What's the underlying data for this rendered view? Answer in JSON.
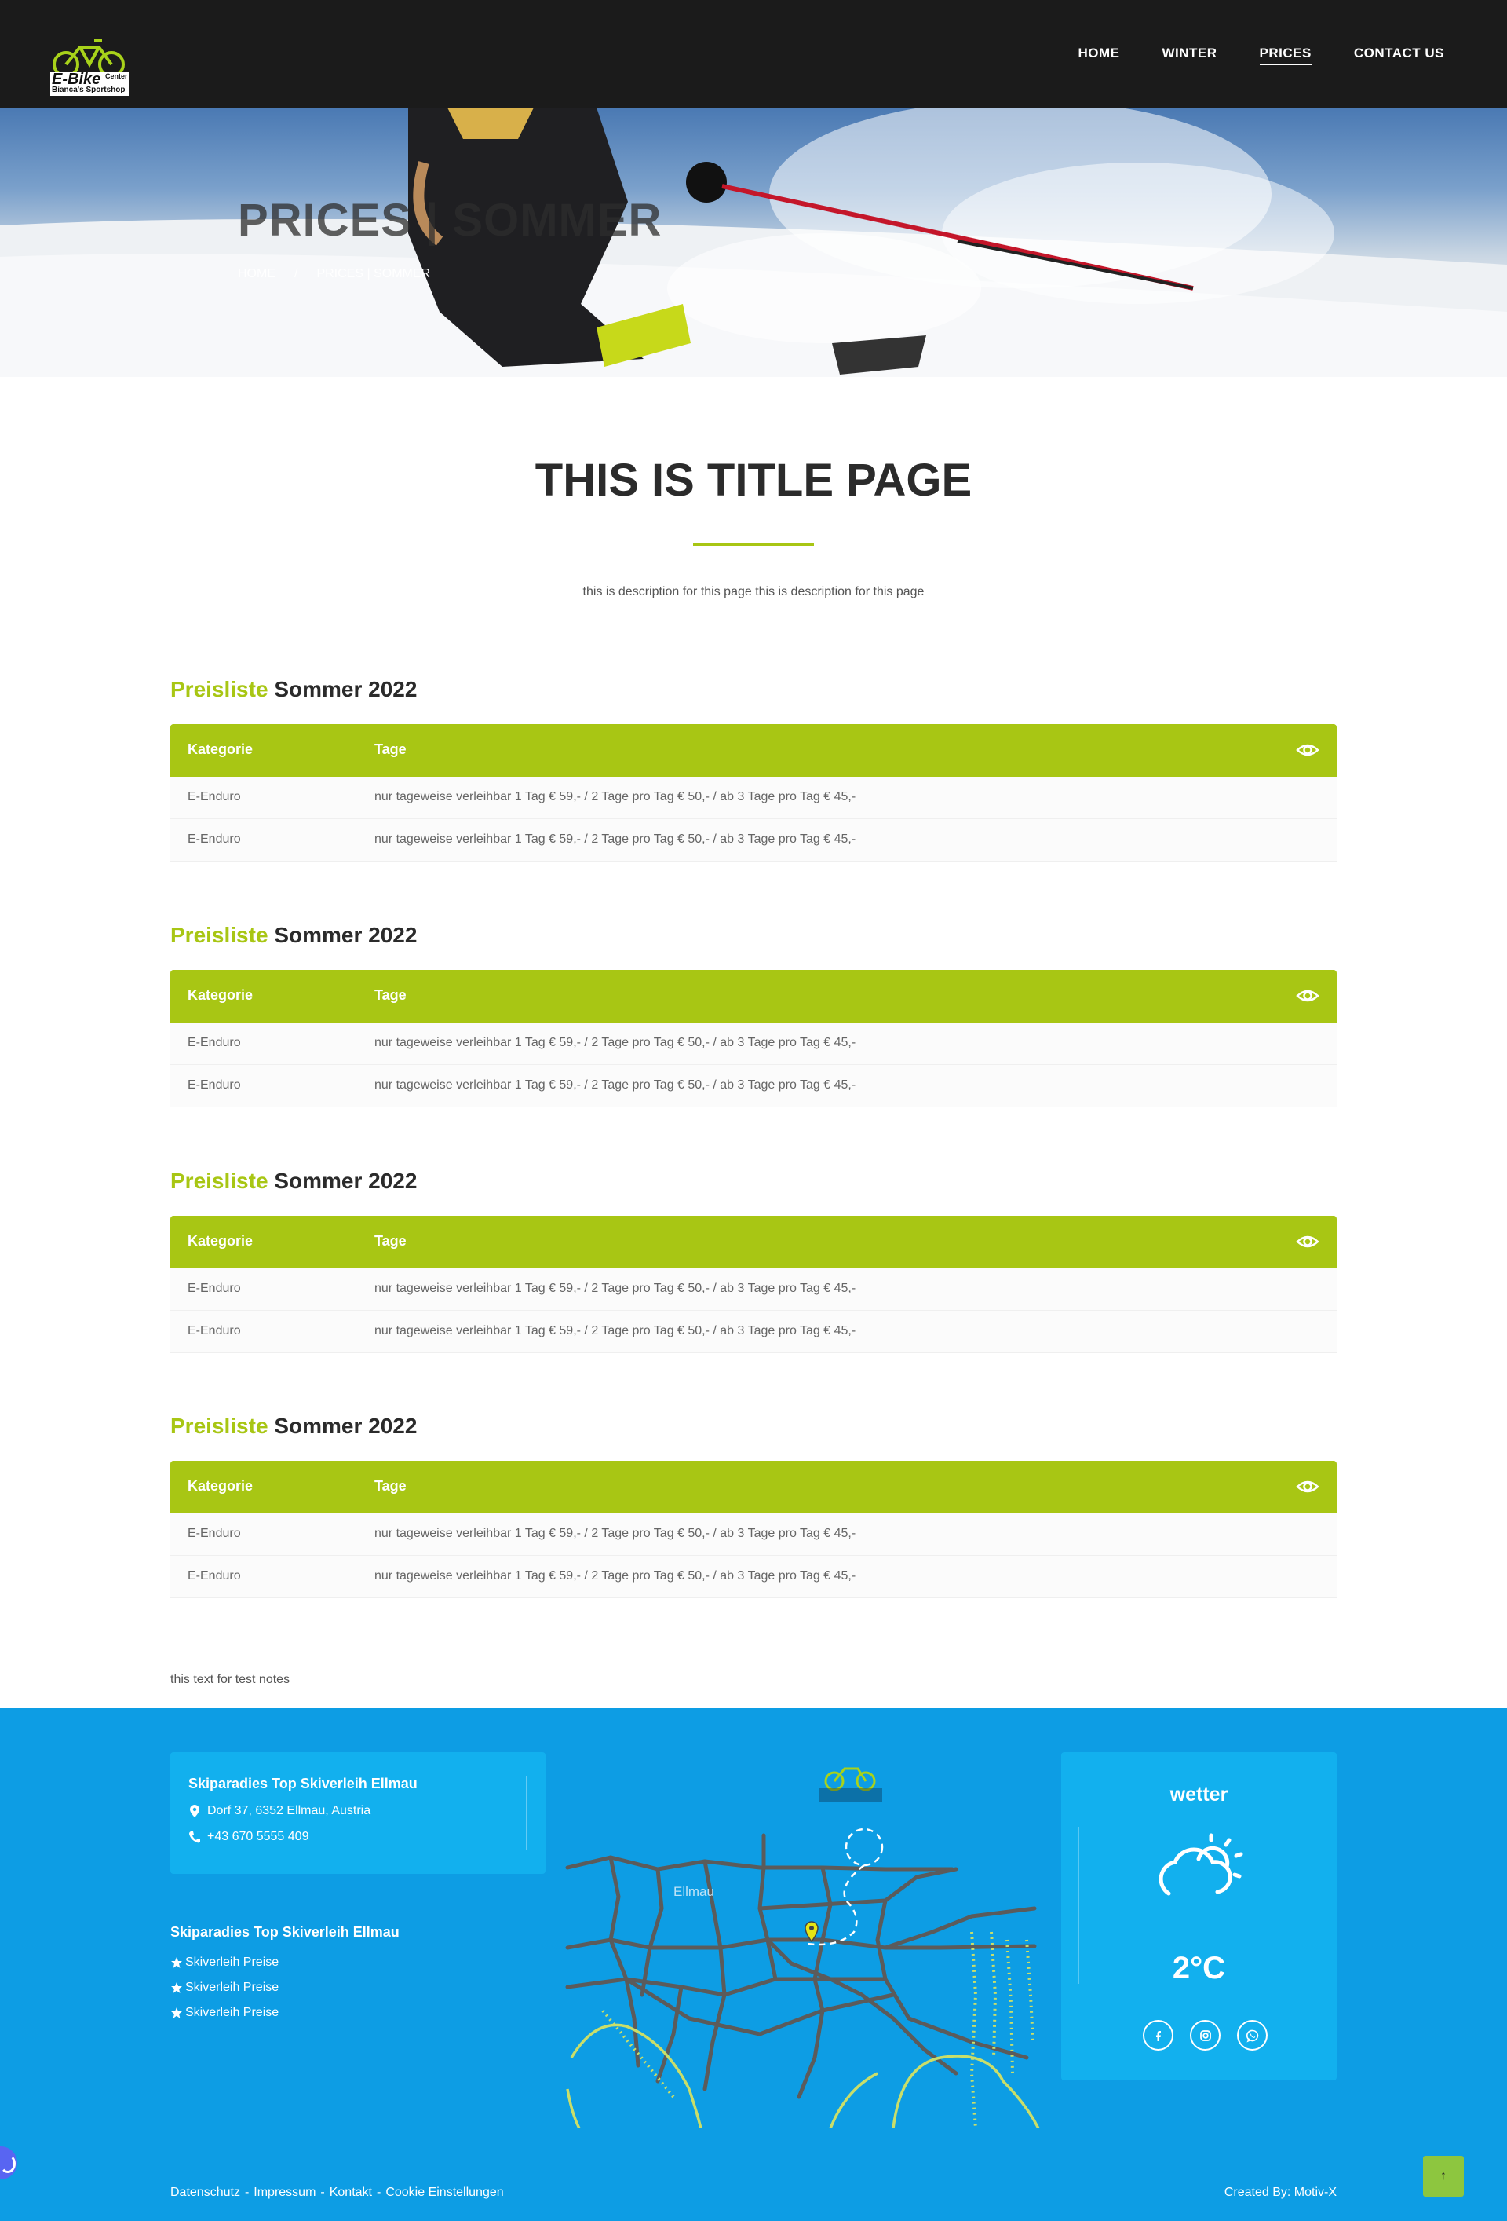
{
  "nav": {
    "items": [
      {
        "label": "HOME",
        "active": false
      },
      {
        "label": "WINTER",
        "active": false
      },
      {
        "label": "PRICES",
        "active": true
      },
      {
        "label": "CONTACT US",
        "active": false
      }
    ],
    "logo": {
      "line1": "E-Bike",
      "line2": "Center",
      "line3": "Bianca's Sportshop"
    }
  },
  "hero": {
    "title": "PRICES | SOMMER",
    "breadcrumb": {
      "home": "HOME",
      "separator": "/",
      "current": "PRICES | SOMMER"
    }
  },
  "main": {
    "title": "THIS IS TITLE PAGE",
    "description": "this is description for this page this is description for this page",
    "accent_color": "#a8c614",
    "sections": [
      {
        "heading_accent": "Preisliste",
        "heading_rest": "Sommer 2022",
        "columns": [
          "Kategorie",
          "Tage"
        ],
        "rows": [
          {
            "kategorie": "E-Enduro",
            "tage": "nur tageweise verleihbar 1 Tag € 59,- / 2 Tage pro Tag € 50,- / ab 3 Tage pro Tag € 45,-"
          },
          {
            "kategorie": "E-Enduro",
            "tage": "nur tageweise verleihbar 1 Tag € 59,- / 2 Tage pro Tag € 50,- / ab 3 Tage pro Tag € 45,-"
          }
        ]
      },
      {
        "heading_accent": "Preisliste",
        "heading_rest": "Sommer 2022",
        "columns": [
          "Kategorie",
          "Tage"
        ],
        "rows": [
          {
            "kategorie": "E-Enduro",
            "tage": "nur tageweise verleihbar 1 Tag € 59,- / 2 Tage pro Tag € 50,- / ab 3 Tage pro Tag € 45,-"
          },
          {
            "kategorie": "E-Enduro",
            "tage": "nur tageweise verleihbar 1 Tag € 59,- / 2 Tage pro Tag € 50,- / ab 3 Tage pro Tag € 45,-"
          }
        ]
      },
      {
        "heading_accent": "Preisliste",
        "heading_rest": "Sommer 2022",
        "columns": [
          "Kategorie",
          "Tage"
        ],
        "rows": [
          {
            "kategorie": "E-Enduro",
            "tage": "nur tageweise verleihbar 1 Tag € 59,- / 2 Tage pro Tag € 50,- / ab 3 Tage pro Tag € 45,-"
          },
          {
            "kategorie": "E-Enduro",
            "tage": "nur tageweise verleihbar 1 Tag € 59,- / 2 Tage pro Tag € 50,- / ab 3 Tage pro Tag € 45,-"
          }
        ]
      },
      {
        "heading_accent": "Preisliste",
        "heading_rest": "Sommer 2022",
        "columns": [
          "Kategorie",
          "Tage"
        ],
        "rows": [
          {
            "kategorie": "E-Enduro",
            "tage": "nur tageweise verleihbar 1 Tag € 59,- / 2 Tage pro Tag € 50,- / ab 3 Tage pro Tag € 45,-"
          },
          {
            "kategorie": "E-Enduro",
            "tage": "nur tageweise verleihbar 1 Tag € 59,- / 2 Tage pro Tag € 50,- / ab 3 Tage pro Tag € 45,-"
          }
        ]
      }
    ],
    "test_notes": "this text for test notes"
  },
  "footer": {
    "background_color": "#0d9de4",
    "address_card": {
      "title": "Skiparadies Top Skiverleih Ellmau",
      "address": "Dorf 37, 6352 Ellmau, Austria",
      "phone": "+43 670 5555 409"
    },
    "links_title": "Skiparadies Top Skiverleih Ellmau",
    "links": [
      "Skiverleih Preise",
      "Skiverleih Preise",
      "Skiverleih Preise"
    ],
    "map": {
      "place_label": "Ellmau"
    },
    "weather": {
      "title": "wetter",
      "temperature": "2°C",
      "icon": "partly-cloudy-icon"
    },
    "socials": [
      "facebook-icon",
      "instagram-icon",
      "whatsapp-icon"
    ],
    "bottom_links": [
      "Datenschutz",
      "Impressum",
      "Kontakt",
      "Cookie Einstellungen"
    ],
    "bottom_separator": "-",
    "credit": "Created By: Motiv-X",
    "to_top_label": "↑"
  }
}
